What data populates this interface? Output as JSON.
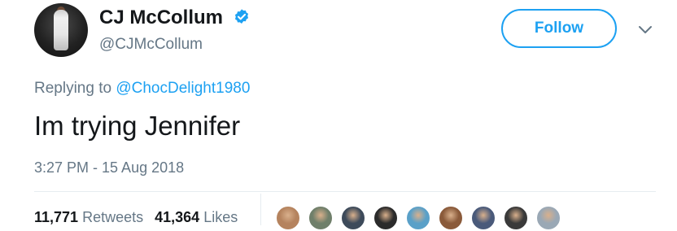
{
  "author": {
    "display_name": "CJ McCollum",
    "handle": "@CJMcCollum",
    "verified": true
  },
  "actions": {
    "follow_label": "Follow"
  },
  "reply": {
    "prefix": "Replying to",
    "to_handle": "@ChocDelight1980"
  },
  "tweet": {
    "text": "Im trying Jennifer",
    "timestamp": "3:27 PM - 15 Aug 2018"
  },
  "stats": {
    "retweets_count": "11,771",
    "retweets_label": "Retweets",
    "likes_count": "41,364",
    "likes_label": "Likes"
  },
  "colors": {
    "accent": "#1da1f2",
    "text_primary": "#14171a",
    "text_secondary": "#657786",
    "divider": "#e6ecf0"
  },
  "liker_avatars": [
    {
      "color": "#b5835e"
    },
    {
      "color": "#6f7f6a"
    },
    {
      "color": "#3d4a5a"
    },
    {
      "color": "#2b2b2b"
    },
    {
      "color": "#5aa0c8"
    },
    {
      "color": "#8a5a3a"
    },
    {
      "color": "#4a5a7a"
    },
    {
      "color": "#3a3a3a"
    },
    {
      "color": "#9aa8b5"
    }
  ]
}
